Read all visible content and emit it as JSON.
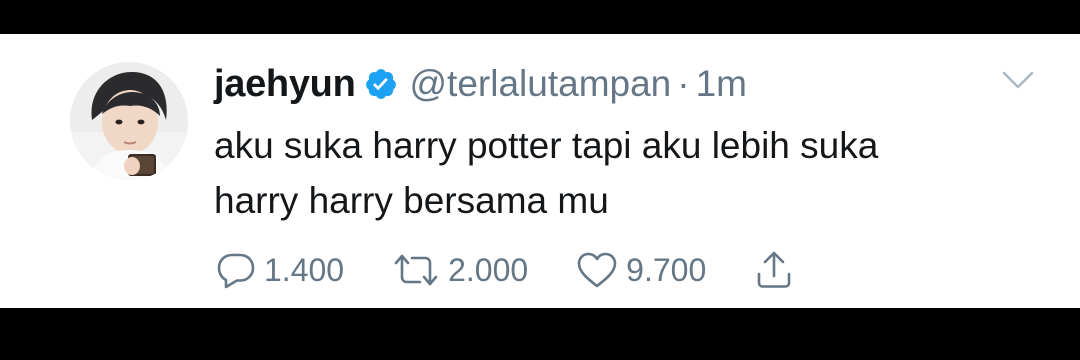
{
  "tweet": {
    "display_name": "jaehyun",
    "handle": "@terlalutampan",
    "separator": "·",
    "time": "1m",
    "text_lines": [
      "aku suka harry potter tapi aku lebih suka",
      "harry harry bersama mu"
    ]
  },
  "actions": {
    "replies": "1.400",
    "retweets": "2.000",
    "likes": "9.700"
  },
  "icons": {
    "verified": "verified-badge-icon",
    "caret": "chevron-down-icon",
    "reply": "reply-icon",
    "retweet": "retweet-icon",
    "like": "heart-icon",
    "share": "share-icon"
  },
  "colors": {
    "text": "#14171a",
    "muted": "#657786",
    "verified": "#1da1f2",
    "background": "#ffffff",
    "letterbox": "#000000"
  }
}
